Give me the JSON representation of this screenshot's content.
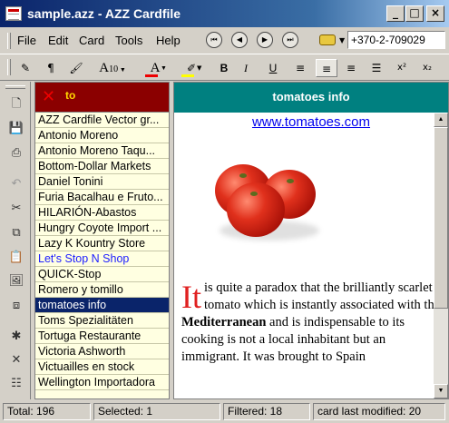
{
  "window": {
    "title": "sample.azz - AZZ Cardfile"
  },
  "menu": [
    "File",
    "Edit",
    "Card",
    "Tools",
    "Help"
  ],
  "nav": {
    "first": "⏮",
    "prev": "◀",
    "next": "▶",
    "last": "⏭"
  },
  "phone": {
    "value": "+370-2-709029"
  },
  "format_toolbar": {
    "font_size": "10",
    "bold": "B",
    "italic": "I",
    "underline": "U",
    "superscript": "x²",
    "subscript": "x₂",
    "font_label": "A"
  },
  "list": {
    "header": "to",
    "items": [
      "AZZ Cardfile Vector gr...",
      "Antonio Moreno",
      "Antonio Moreno Taqu...",
      "Bottom-Dollar Markets",
      "Daniel Tonini",
      "Furia Bacalhau e Fruto...",
      "HILARIÓN-Abastos",
      "Hungry Coyote Import ...",
      "Lazy K Kountry Store",
      "Let's Stop N Shop",
      "QUICK-Stop",
      "Romero y tomillo",
      "tomatoes info",
      "Toms Spezialitäten",
      "Tortuga Restaurante",
      "Victoria Ashworth",
      "Victuailles en stock",
      "Wellington Importadora"
    ],
    "selected_index": 12,
    "highlight_index": 9
  },
  "card": {
    "title": "tomatoes info",
    "url": "www.tomatoes.com",
    "drop_cap": "It",
    "text1": " is quite a paradox that the brilliantly scarlet tomato which is instantly associated with the ",
    "bold": "Mediterranean",
    "text2": " and is indispensable to its cooking is not a local inhabitant but an immigrant. It was brought to Spain"
  },
  "status": {
    "total": "Total: 196",
    "selected": "Selected: 1",
    "filtered": "Filtered: 18",
    "modified": "card last modified: 20"
  },
  "colors": {
    "accent": "#0a246a",
    "card_header": "#008080",
    "list_header": "#8b0000",
    "list_bg": "#ffffe1"
  }
}
